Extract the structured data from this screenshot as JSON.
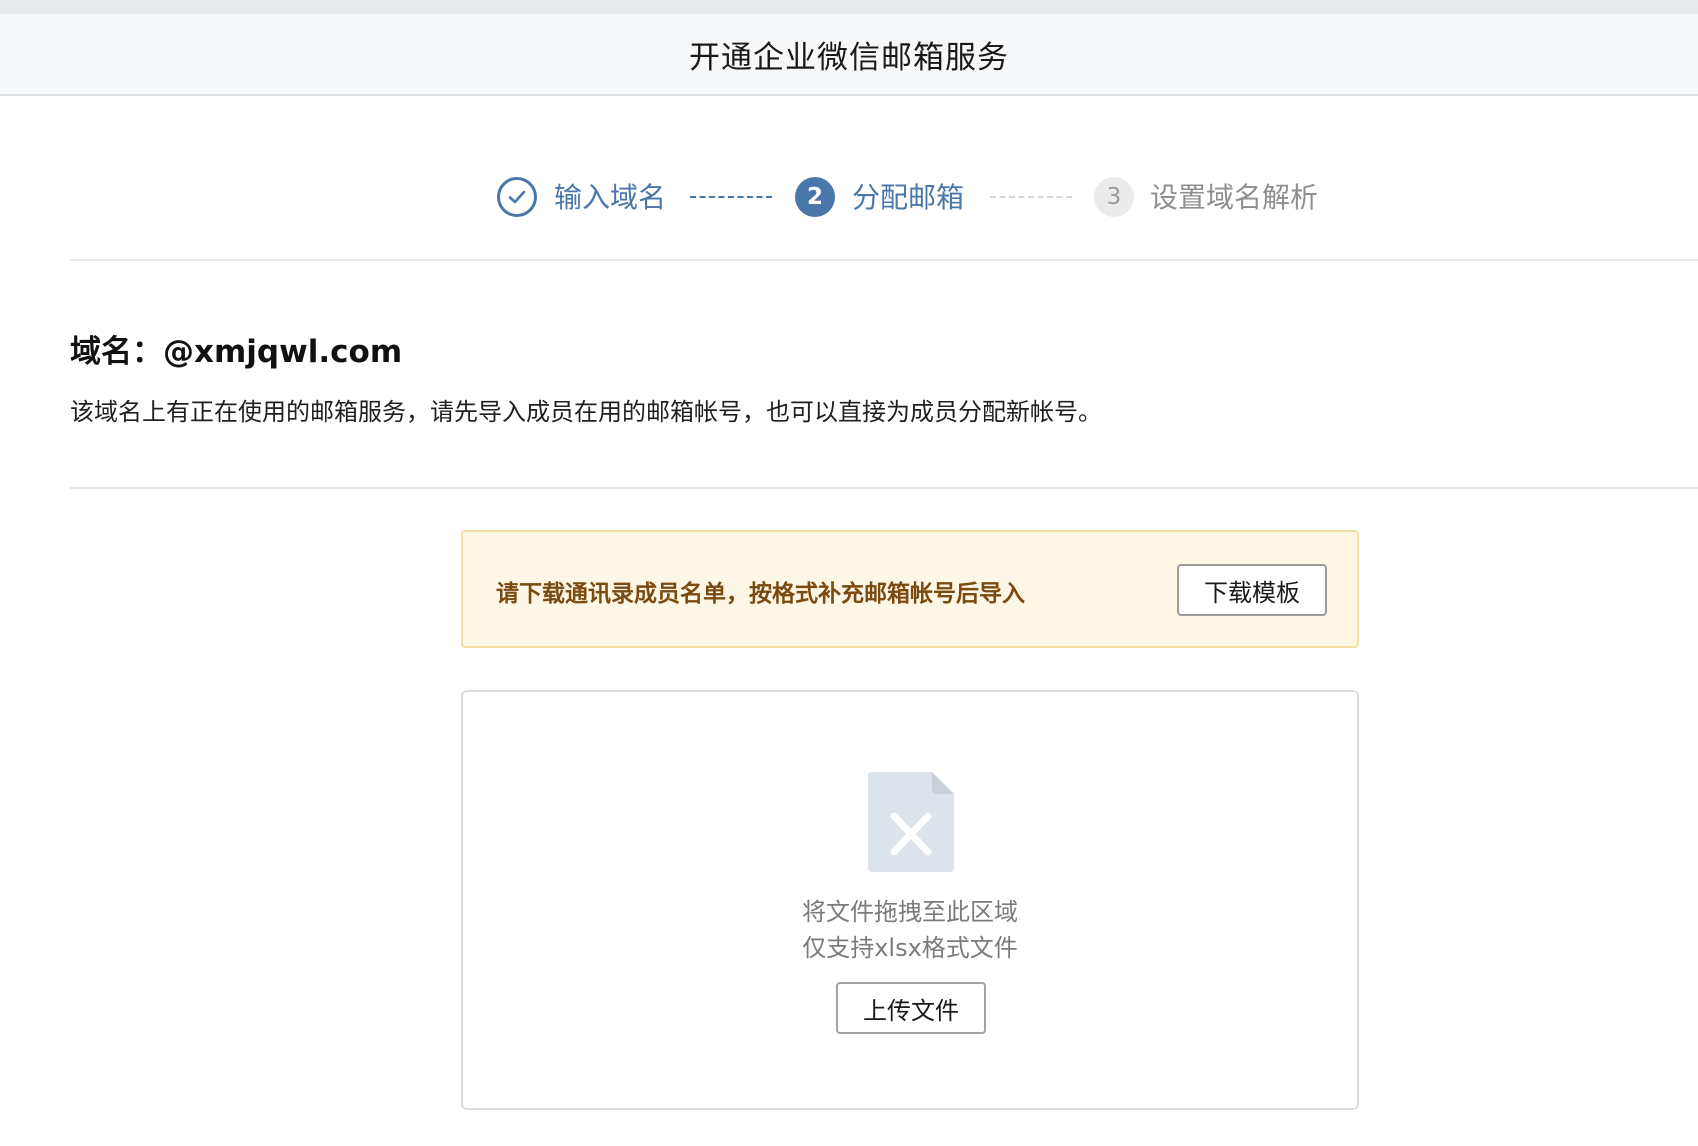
{
  "header": {
    "title": "开通企业微信邮箱服务"
  },
  "steps": [
    {
      "number": "1",
      "label": "输入域名",
      "state": "done",
      "icon": "check-circle-icon"
    },
    {
      "number": "2",
      "label": "分配邮箱",
      "state": "active"
    },
    {
      "number": "3",
      "label": "设置域名解析",
      "state": "pending"
    }
  ],
  "domain": {
    "label": "域名：",
    "value": "@xmjqwl.com",
    "description": "该域名上有正在使用的邮箱服务，请先导入成员在用的邮箱帐号，也可以直接为成员分配新帐号。"
  },
  "notice": {
    "text": "请下载通讯录成员名单，按格式补充邮箱帐号后导入",
    "button_label": "下载模板"
  },
  "upload": {
    "icon": "excel-file-icon",
    "hint_drag": "将文件拖拽至此区域",
    "hint_format": "仅支持xlsx格式文件",
    "button_label": "上传文件"
  },
  "colors": {
    "accent": "#4a77a9",
    "notice_bg": "#fef7e6",
    "notice_border": "#f6dfa3",
    "notice_text": "#7a4a11",
    "pending": "#9a9a9a"
  }
}
